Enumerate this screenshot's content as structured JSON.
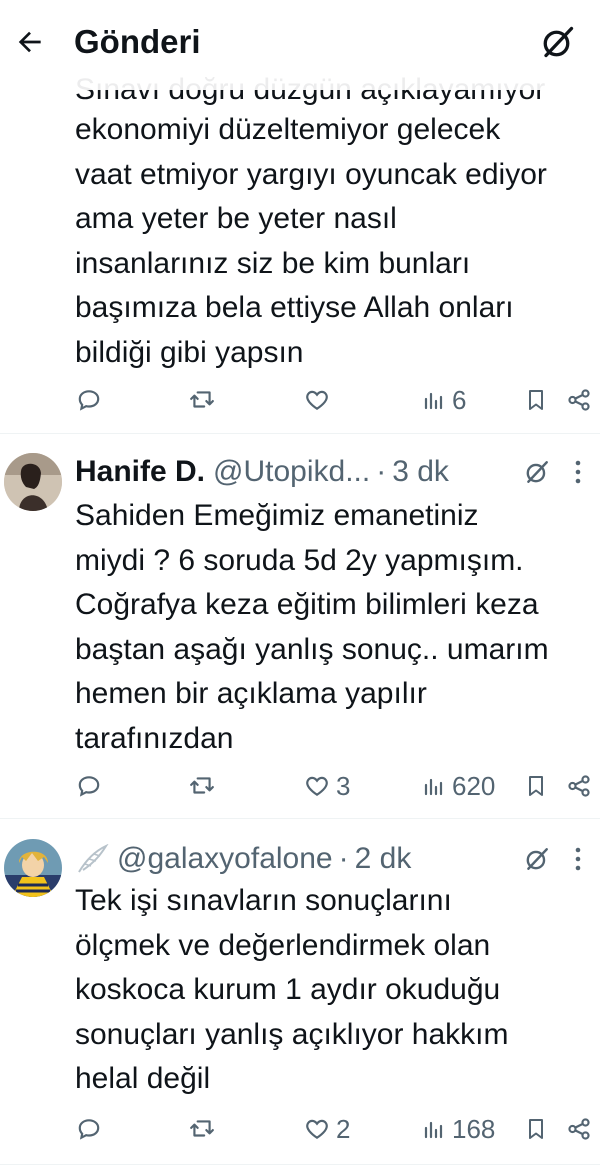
{
  "header": {
    "title": "Gönderi"
  },
  "tweets": [
    {
      "partial_first_line": "Sınavı doğru düzgün açıklayamıyor",
      "text": "ekonomiyi düzeltemiyor gelecek\nvaat etmiyor yargıyı oyuncak ediyor\nama yeter be yeter nasıl\ninsanlarınız siz be kim bunları\nbaşımıza bela ettiyse Allah onları\nbildiği gibi yapsın",
      "likes": "",
      "views": "6"
    },
    {
      "name": "Hanife D.",
      "handle": "@Utopikd...",
      "dot": "·",
      "time": "3 dk",
      "text": "Sahiden Emeğimiz emanetiniz\nmiydi ? 6 soruda 5d 2y yapmışım.\nCoğrafya keza eğitim bilimleri keza\nbaştan aşağı yanlış sonuç.. umarım\nhemen bir açıklama yapılır\ntarafınızdan",
      "likes": "3",
      "views": "620"
    },
    {
      "handle": "@galaxyofalone",
      "dot": "·",
      "time": "2 dk",
      "text": "Tek işi sınavların sonuçlarını\nölçmek ve değerlendirmek olan\nkoskoca kurum 1 aydır okuduğu\nsonuçları yanlış açıklıyor hakkım\nhelal değil",
      "likes": "2",
      "views": "168"
    }
  ],
  "icons": {
    "back": "arrow-left-icon",
    "grok": "grok-icon",
    "reply": "reply-icon",
    "retweet": "retweet-icon",
    "like": "heart-icon",
    "views": "views-bar-icon",
    "bookmark": "bookmark-icon",
    "share": "share-icon",
    "more": "more-dots-icon"
  },
  "colors": {
    "text": "#0f1419",
    "secondary": "#536471",
    "divider": "#eff3f4"
  }
}
